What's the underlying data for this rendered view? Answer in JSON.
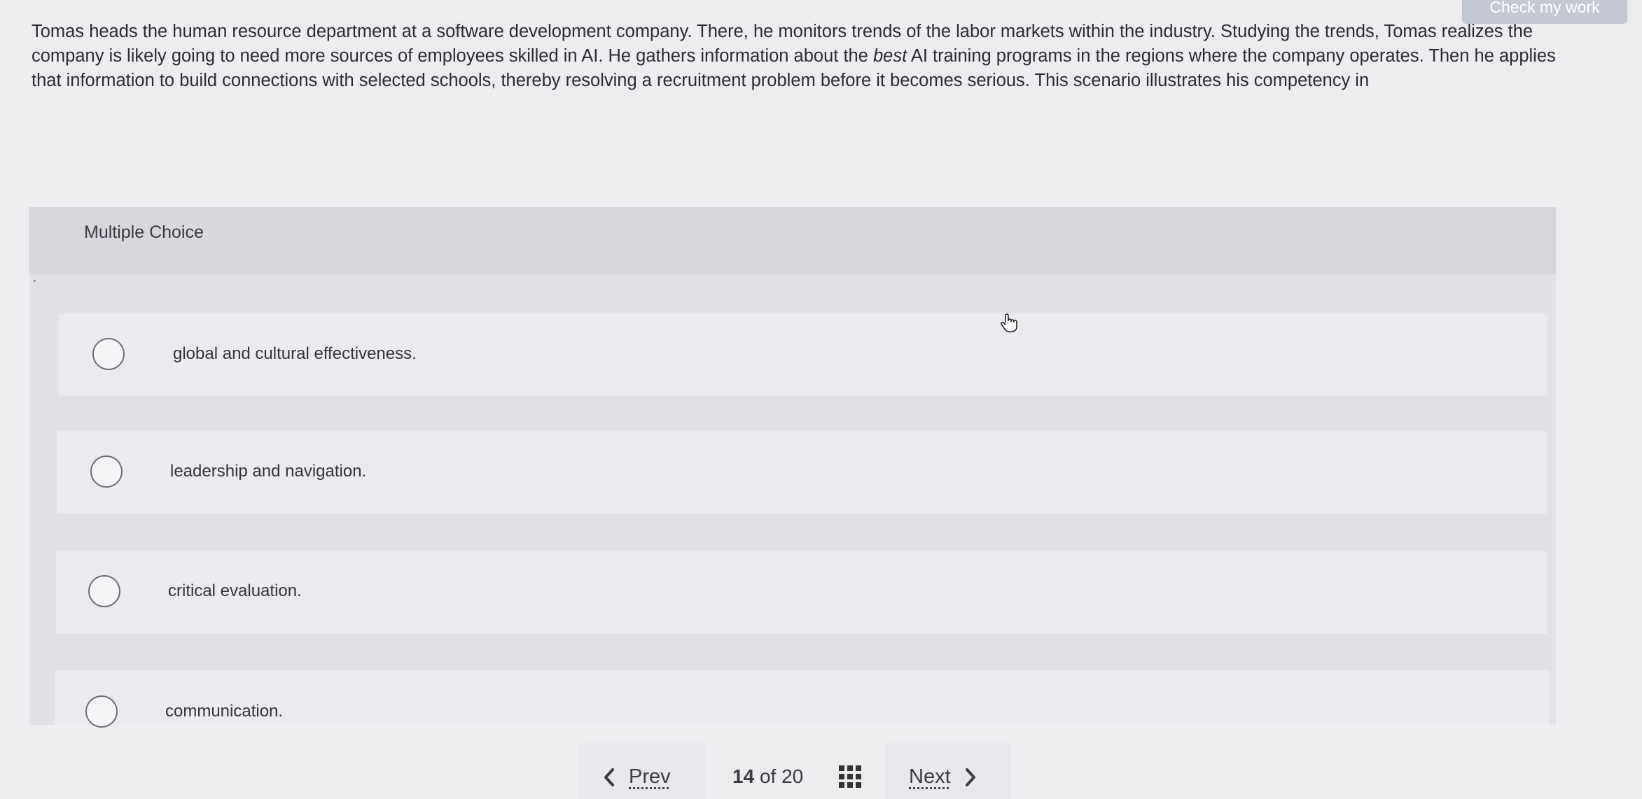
{
  "header": {
    "check_my_work": "Check my work"
  },
  "question": {
    "text_before": "Tomas heads the human resource department at a software development company. There, he monitors trends of the labor markets within the industry. Studying the trends, Tomas realizes the company is likely going to need more sources of employees skilled in AI. He gathers information about the ",
    "emphasis": "best",
    "text_after": " AI training programs in the regions where the company operates. Then he applies that information to build connections with selected schools, thereby resolving a recruitment problem before it becomes serious. This scenario illustrates his competency in"
  },
  "panel": {
    "title": "Multiple Choice",
    "options": [
      {
        "label": "global and cultural effectiveness."
      },
      {
        "label": "leadership and navigation."
      },
      {
        "label": "critical evaluation."
      },
      {
        "label": "communication."
      }
    ]
  },
  "footer": {
    "prev_label": "Prev",
    "next_label": "Next",
    "current": "14",
    "of_label": "of",
    "total": "20"
  },
  "colors": {
    "accent": "#3b3b44",
    "panel": "#e1e1e7",
    "button": "#c4c8d2"
  },
  "icons": [
    "chevron-left-icon",
    "chevron-right-icon",
    "grid-icon",
    "hand-cursor-icon",
    "radio-icon"
  ]
}
